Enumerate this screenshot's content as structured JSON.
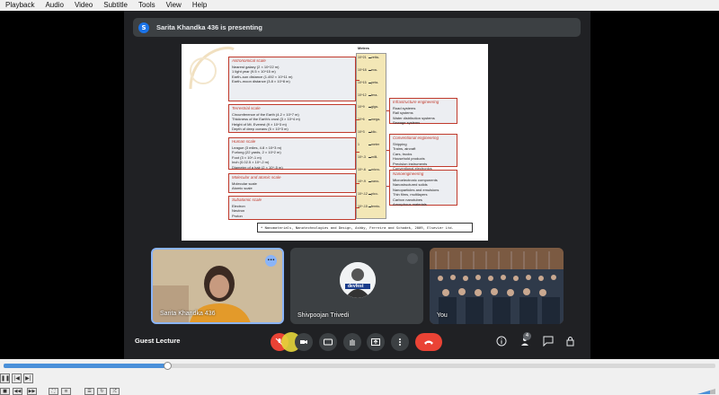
{
  "menubar": {
    "items": [
      "Playback",
      "Audio",
      "Video",
      "Subtitle",
      "Tools",
      "View",
      "Help"
    ]
  },
  "banner": {
    "avatar_letter": "S",
    "text": "Sarita Khandka 436 is presenting"
  },
  "slide": {
    "scale_header": "Metres",
    "ticks": [
      {
        "exp": "10^21",
        "prefix": "zetta-"
      },
      {
        "exp": "10^18",
        "prefix": "exa-"
      },
      {
        "exp": "10^15",
        "prefix": "peta-"
      },
      {
        "exp": "10^12",
        "prefix": "tera-"
      },
      {
        "exp": "10^9",
        "prefix": "giga-"
      },
      {
        "exp": "10^6",
        "prefix": "mega-"
      },
      {
        "exp": "10^3",
        "prefix": "kilo-"
      },
      {
        "exp": "1",
        "prefix": "meter"
      },
      {
        "exp": "10^-3",
        "prefix": "milli-"
      },
      {
        "exp": "10^-6",
        "prefix": "micro-"
      },
      {
        "exp": "10^-9",
        "prefix": "nano-"
      },
      {
        "exp": "10^-12",
        "prefix": "pico-"
      },
      {
        "exp": "10^-15",
        "prefix": "femto-"
      }
    ],
    "left_boxes": [
      {
        "title": "Astronomical scale",
        "lines": [
          "Nearest galaxy (2 × 10^22 m)",
          "1 light year (9.5 × 10^15 m)",
          "Earth–sun distance (1.492 × 10^11 m)",
          "Earth–moon distance (3.8 × 10^8 m)"
        ]
      },
      {
        "title": "Terrestrial scale",
        "lines": [
          "Circumference of the Earth (4.2 × 10^7 m)",
          "Thickness of the Earth's crust (3 × 10^4 m)",
          "Height of Mt. Everest (9 × 10^3 m)",
          "Depth of deep oceans (5 × 10^3 m)"
        ]
      },
      {
        "title": "Human scale",
        "lines": [
          "League (3 miles, 4.8 × 10^3 m)",
          "Furlong (22 yards, 2 × 10^2 m)",
          "Foot (3 × 10^-1 m)",
          "Inch (0.02.5 × 10^-2 m)",
          "Diameter of a hair (2 × 10^-5 m)"
        ]
      },
      {
        "title": "Molecular and atomic scale",
        "lines": [
          "Molecular scale",
          "Atomic scale"
        ]
      },
      {
        "title": "Subatomic scale",
        "lines": [
          "Electron",
          "Neutron",
          "Proton"
        ]
      }
    ],
    "right_boxes": [
      {
        "title": "Infrastructure engineering",
        "lines": [
          "Road systems",
          "Rail systems",
          "Water distribution systems",
          "Sewage systems"
        ]
      },
      {
        "title": "Conventional engineering",
        "lines": [
          "Shipping",
          "Trains, aircraft",
          "Cars, trucks",
          "Household products",
          "Precision instruments",
          "Conventional electronics"
        ]
      },
      {
        "title": "Nanoengineering",
        "lines": [
          "Microelectronic components",
          "Nanostructured solids",
          "Nanoparticles and emulsions",
          "Thin films, multilayers",
          "Carbon nanotubes",
          "Amorphous materials"
        ]
      }
    ],
    "citation": "* Nanomaterials, Nanotechnologies and Design, Ashby, Ferreira and Schodek, 2009,  Elsevier Ltd."
  },
  "tiles": [
    {
      "name": "Sarita Khandka 436",
      "more": "⋯"
    },
    {
      "name": "Shivpoojan Trivedi",
      "logo": "devfest"
    },
    {
      "name": "You"
    }
  ],
  "controls": {
    "meeting_name": "Guest Lecture",
    "people_count": "4"
  },
  "player": {
    "progress_fraction": 0.23
  },
  "colors": {
    "meet_bg": "#202124",
    "accent": "#8ab4f8",
    "end_call": "#ea4335",
    "slide_red": "#c0392b"
  }
}
